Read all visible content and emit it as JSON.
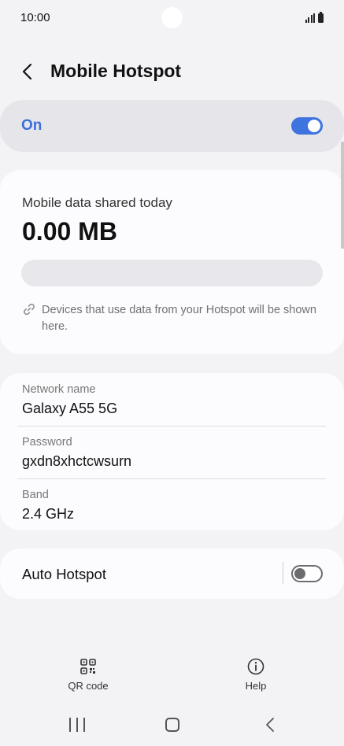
{
  "status_bar": {
    "time": "10:00"
  },
  "header": {
    "title": "Mobile Hotspot"
  },
  "master_switch": {
    "label": "On",
    "state": "on",
    "accent_color": "#3e73e0"
  },
  "usage": {
    "label": "Mobile data shared today",
    "value": "0.00 MB",
    "progress_fraction": 0,
    "note": "Devices that use data from your Hotspot will be shown here."
  },
  "network": {
    "rows": [
      {
        "label": "Network name",
        "value": "Galaxy A55 5G"
      },
      {
        "label": "Password",
        "value": "gxdn8xhctcwsurn"
      },
      {
        "label": "Band",
        "value": "2.4 GHz"
      }
    ]
  },
  "auto_hotspot": {
    "label": "Auto Hotspot",
    "state": "off"
  },
  "bottom_actions": {
    "qr_label": "QR code",
    "help_label": "Help"
  },
  "icons": {
    "back": "chevron-left-icon",
    "link": "link-icon",
    "qr": "qr-code-icon",
    "help": "info-icon"
  }
}
